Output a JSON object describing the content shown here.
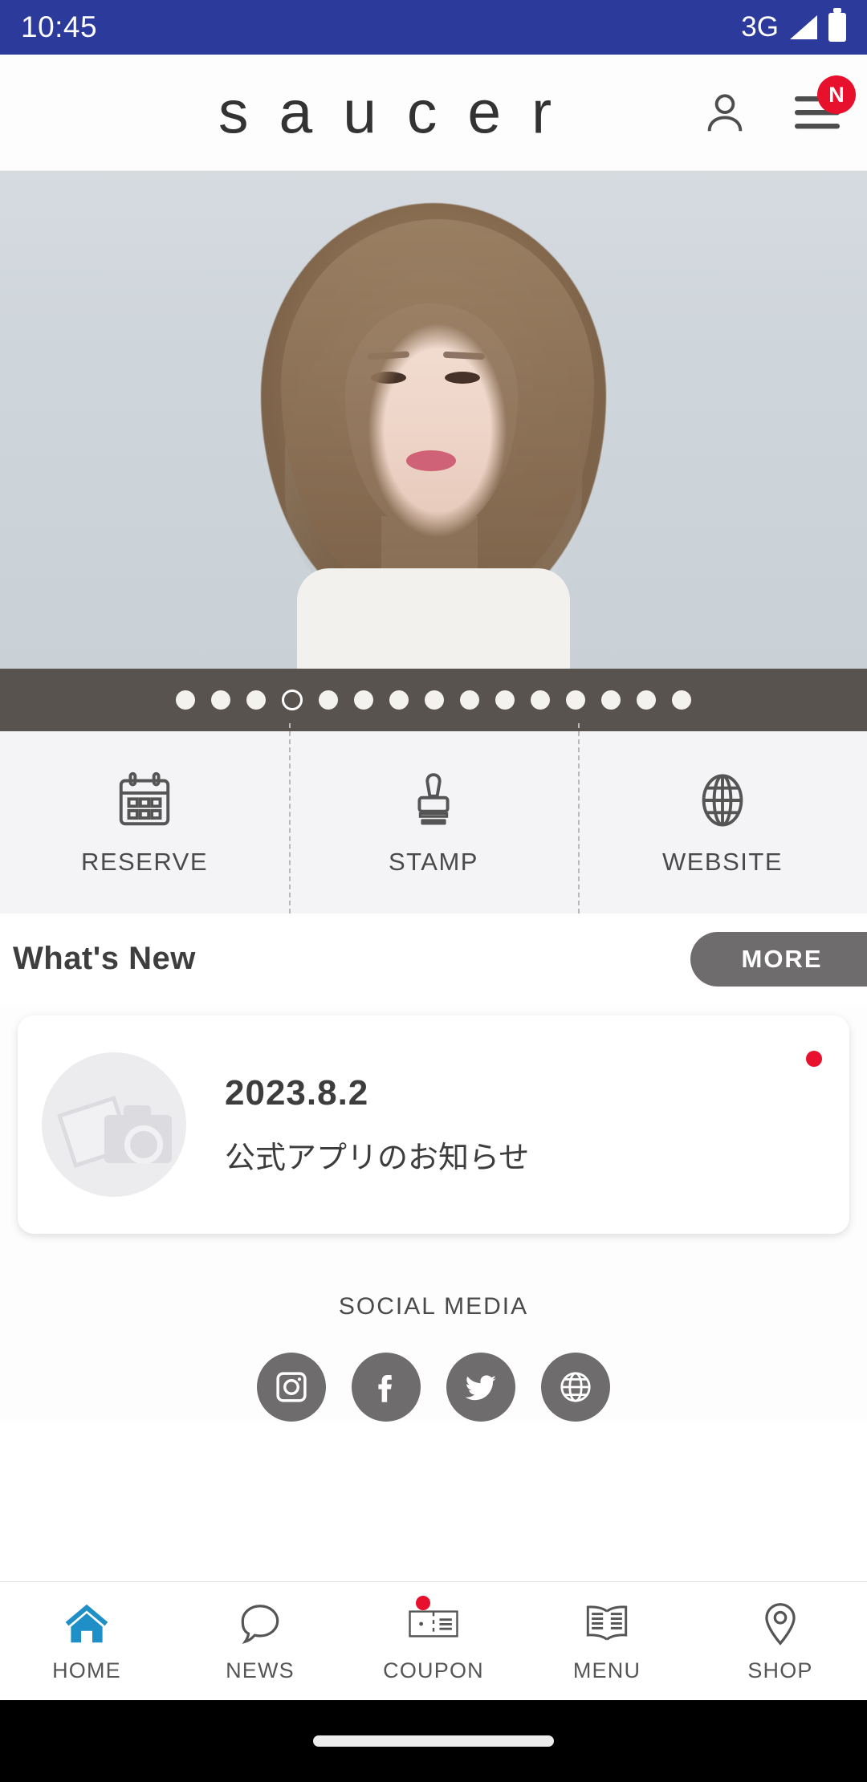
{
  "status_bar": {
    "time": "10:45",
    "network": "3G",
    "signal_icon": "signal-triangle-icon",
    "battery_icon": "battery-full-icon"
  },
  "header": {
    "logo_text": "saucer",
    "account_icon": "person-icon",
    "menu_icon": "hamburger-menu-icon",
    "menu_badge": "N",
    "badge_color": "#e8112d"
  },
  "hero": {
    "alt": "hair-salon-model-photo",
    "total_slides": 15,
    "active_slide": 4
  },
  "quick_actions": [
    {
      "label": "RESERVE",
      "icon": "calendar-icon"
    },
    {
      "label": "STAMP",
      "icon": "stamp-icon"
    },
    {
      "label": "WEBSITE",
      "icon": "globe-icon"
    }
  ],
  "whats_new": {
    "title": "What's New",
    "more_label": "MORE",
    "more_color": "#6e6c6c",
    "items": [
      {
        "date": "2023.8.2",
        "title": "公式アプリのお知らせ",
        "thumbnail_icon": "photo-placeholder-icon",
        "unread": true
      }
    ]
  },
  "social_media": {
    "title": "SOCIAL MEDIA",
    "icon_bg": "#6e6c6c",
    "items": [
      {
        "name": "instagram-icon"
      },
      {
        "name": "facebook-icon"
      },
      {
        "name": "twitter-icon"
      },
      {
        "name": "website-globe-icon"
      }
    ]
  },
  "bottom_nav": {
    "active_color": "#1f8fc8",
    "inactive_color": "#555555",
    "items": [
      {
        "label": "HOME",
        "icon": "home-icon",
        "active": true,
        "badge": false
      },
      {
        "label": "NEWS",
        "icon": "chat-bubble-icon",
        "active": false,
        "badge": false
      },
      {
        "label": "COUPON",
        "icon": "ticket-icon",
        "active": false,
        "badge": true
      },
      {
        "label": "MENU",
        "icon": "open-book-icon",
        "active": false,
        "badge": false
      },
      {
        "label": "SHOP",
        "icon": "map-pin-icon",
        "active": false,
        "badge": false
      }
    ]
  },
  "system_nav": {
    "gesture_bar": "home-gesture-pill"
  }
}
